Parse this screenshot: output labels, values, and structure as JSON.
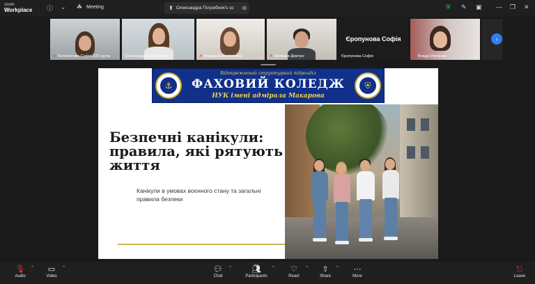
{
  "app": {
    "brand_top": "zoom",
    "brand_bottom": "Workplace",
    "meeting_label": "Meeting"
  },
  "share_indicator": {
    "text": "Олександра Погребняк's sc"
  },
  "participants": [
    {
      "name": "Богомолова Софія 225 група",
      "muted": true
    },
    {
      "name": "Олександра Погребняк",
      "muted": false,
      "active": true
    },
    {
      "name": "Андрєєва Валентина",
      "muted": true
    },
    {
      "name": "Матвєєв Дмитро",
      "muted": true
    },
    {
      "name": "Єропунова Софія",
      "muted": false,
      "video_off": true
    },
    {
      "name": "Влада Ілюченко",
      "muted": true
    }
  ],
  "slide": {
    "banner_sub": "Відокремлений структурний підрозділ",
    "banner_main": "ФАХОВИЙ КОЛЕДЖ",
    "banner_adm": "НУК імені адмірала Макарова",
    "title": "Безпечні канікули: правила, які рятують життя",
    "subtitle": "Канікули в умовах воєнного стану та загальні правила безпеки"
  },
  "toolbar": {
    "audio": "Audio",
    "video": "Video",
    "chat": "Chat",
    "participants": "Participants",
    "participants_count": "64",
    "react": "React",
    "share": "Share",
    "more": "More",
    "leave": "Leave"
  },
  "colors": {
    "active_outline": "#3fcf5d",
    "mute_red": "#e14242",
    "next_blue": "#2f7ef7",
    "banner_blue": "#10308a",
    "banner_gold": "#f2d34a"
  }
}
